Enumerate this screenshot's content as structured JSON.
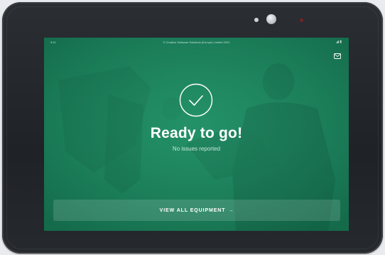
{
  "status_bar": {
    "time": "9:41",
    "copyright": "© Creative Software Solutions (Europe) Limited 2021",
    "icons": "◢ ▮"
  },
  "header": {
    "inbox_icon": "envelope-icon"
  },
  "status": {
    "icon": "check-circle-icon",
    "title": "Ready to go!",
    "subtitle": "No issues reported"
  },
  "cta": {
    "label": "VIEW ALL EQUIPMENT",
    "arrow": "→"
  },
  "colors": {
    "screen": "#1e8a62",
    "text": "#ffffff",
    "bezel": "#23262a"
  }
}
